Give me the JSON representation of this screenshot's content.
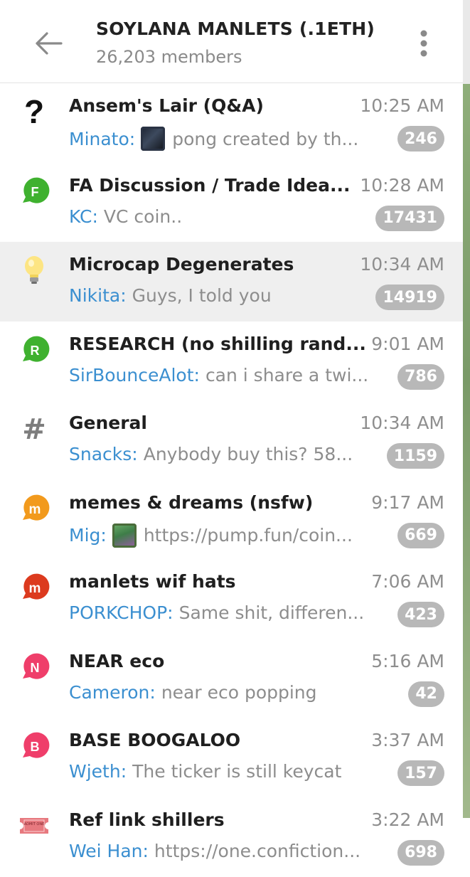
{
  "header": {
    "title": "SOYLANA MANLETS (.1ETH)",
    "members": "26,203 members"
  },
  "chats": [
    {
      "title": "Ansem's Lair (Q&A)",
      "time": "10:25 AM",
      "sender": "Minato:",
      "message": "pong created by th...",
      "unread": "246",
      "icon": "question-mark-icon"
    },
    {
      "title": "FA Discussion / Trade Idea...",
      "time": "10:28 AM",
      "sender": "KC:",
      "message": "VC coin..",
      "unread": "17431",
      "icon": "letter-f-bubble-icon",
      "letter": "F",
      "color": "#3fb12f"
    },
    {
      "title": "Microcap Degenerates",
      "time": "10:34 AM",
      "sender": "Nikita:",
      "message": "Guys, I told you",
      "unread": "14919",
      "icon": "light-bulb-icon"
    },
    {
      "title": "RESEARCH (no shilling rand...",
      "time": "9:01 AM",
      "sender": "SirBounceAlot:",
      "message": "can i share a twi...",
      "unread": "786",
      "icon": "letter-r-bubble-icon",
      "letter": "R",
      "color": "#3fb12f"
    },
    {
      "title": "General",
      "time": "10:34 AM",
      "sender": "Snacks:",
      "message": "Anybody buy this? 58...",
      "unread": "1159",
      "icon": "hash-icon"
    },
    {
      "title": "memes & dreams (nsfw)",
      "time": "9:17 AM",
      "sender": "Mig:",
      "message": "https://pump.fun/coin...",
      "unread": "669",
      "icon": "letter-m-bubble-icon",
      "letter": "m",
      "color": "#f29a1d"
    },
    {
      "title": "manlets wif hats",
      "time": "7:06 AM",
      "sender": "PORKCHOP:",
      "message": "Same shit, differen...",
      "unread": "423",
      "icon": "letter-m-bubble-icon",
      "letter": "m",
      "color": "#dc3a1e"
    },
    {
      "title": "NEAR eco",
      "time": "5:16 AM",
      "sender": "Cameron:",
      "message": "near eco popping",
      "unread": "42",
      "icon": "letter-n-bubble-icon",
      "letter": "N",
      "color": "#ef3e6a"
    },
    {
      "title": "BASE BOOGALOO",
      "time": "3:37 AM",
      "sender": "Wjeth:",
      "message": "The ticker is still keycat",
      "unread": "157",
      "icon": "letter-b-bubble-icon",
      "letter": "B",
      "color": "#ef3e6a"
    },
    {
      "title": "Ref link shillers",
      "time": "3:22 AM",
      "sender": "Wei Han:",
      "message": "https://one.confiction...",
      "unread": "698",
      "icon": "ticket-icon",
      "ticket_text": "ADMIT ONE"
    }
  ]
}
